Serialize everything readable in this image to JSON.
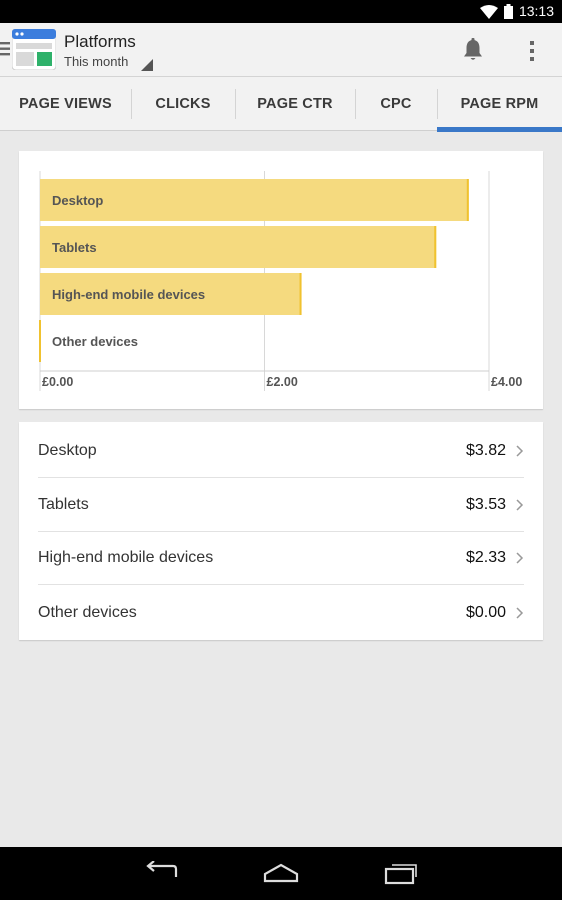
{
  "status_bar": {
    "time": "13:13"
  },
  "header": {
    "title": "Platforms",
    "subtitle": "This month"
  },
  "tabs": [
    {
      "label": "PAGE VIEWS",
      "active": false
    },
    {
      "label": "CLICKS",
      "active": false
    },
    {
      "label": "PAGE CTR",
      "active": false
    },
    {
      "label": "CPC",
      "active": false
    },
    {
      "label": "PAGE RPM",
      "active": true
    }
  ],
  "chart_data": {
    "type": "bar",
    "orientation": "horizontal",
    "categories": [
      "Desktop",
      "Tablets",
      "High-end mobile devices",
      "Other devices"
    ],
    "values": [
      3.82,
      3.53,
      2.33,
      0.0
    ],
    "xlim": [
      0,
      4
    ],
    "x_ticks": [
      "£0.00",
      "£2.00",
      "£4.00"
    ],
    "grid": true,
    "bar_color": "#f5da7f",
    "bar_edge_color": "#f0c22f"
  },
  "list": [
    {
      "label": "Desktop",
      "value": "$3.82"
    },
    {
      "label": "Tablets",
      "value": "$3.53"
    },
    {
      "label": "High-end mobile devices",
      "value": "$2.33"
    },
    {
      "label": "Other devices",
      "value": "$0.00"
    }
  ],
  "colors": {
    "accent": "#3a78c8",
    "background": "#e9e9e9"
  },
  "icons": {
    "app": "adsense-app-icon",
    "notifications": "bell-icon",
    "menu": "overflow-menu-icon"
  }
}
